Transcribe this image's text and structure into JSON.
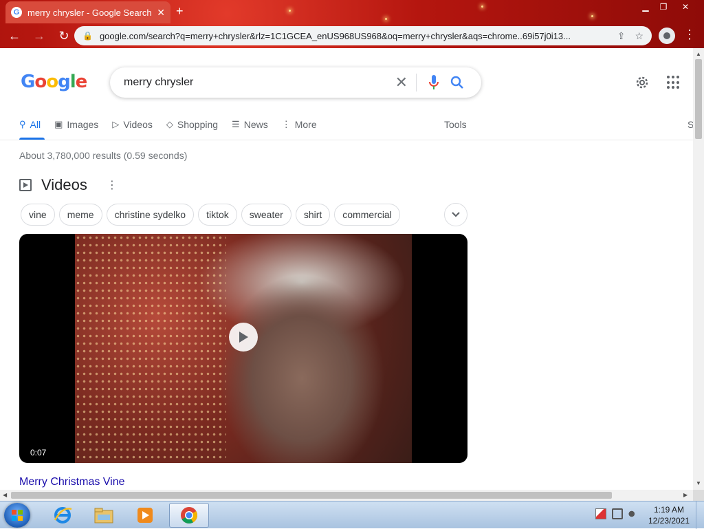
{
  "browser": {
    "tab_title": "merry chrysler - Google Search",
    "url": "google.com/search?q=merry+chrysler&rlz=1C1GCEA_enUS968US968&oq=merry+chrysler&aqs=chrome..69i57j0i13..."
  },
  "search": {
    "query": "merry chrysler",
    "logo_text": "Google"
  },
  "tabs": [
    {
      "label": "All",
      "icon": "search-icon"
    },
    {
      "label": "Images",
      "icon": "image-icon"
    },
    {
      "label": "Videos",
      "icon": "play-icon"
    },
    {
      "label": "Shopping",
      "icon": "tag-icon"
    },
    {
      "label": "News",
      "icon": "newspaper-icon"
    },
    {
      "label": "More",
      "icon": "more-vertical-icon"
    }
  ],
  "tools_label": "Tools",
  "safesearch_label": "S",
  "result_stats": "About 3,780,000 results (0.59 seconds)",
  "videos": {
    "heading": "Videos",
    "chips": [
      "vine",
      "meme",
      "christine sydelko",
      "tiktok",
      "sweater",
      "shirt",
      "commercial"
    ],
    "duration": "0:07",
    "title": "Merry Christmas Vine"
  },
  "taskbar": {
    "time": "1:19 AM",
    "date": "12/23/2021"
  },
  "colors": {
    "link": "#1a0dab",
    "active_tab": "#1a73e8",
    "chrome_theme": "#b5160f"
  }
}
